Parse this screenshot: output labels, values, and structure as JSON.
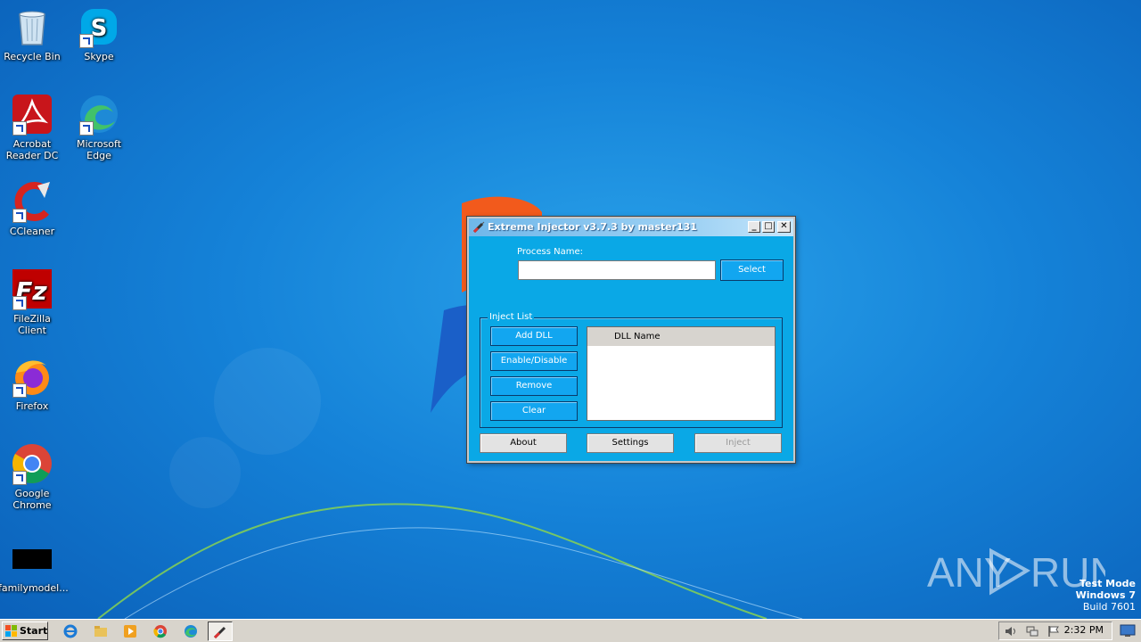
{
  "desktop": {
    "icons": [
      {
        "label": "Recycle Bin"
      },
      {
        "label": "Skype"
      },
      {
        "label": "Acrobat Reader DC"
      },
      {
        "label": "Microsoft Edge"
      },
      {
        "label": "CCleaner"
      },
      {
        "label": "FileZilla Client"
      },
      {
        "label": "Firefox"
      },
      {
        "label": "Google Chrome"
      },
      {
        "label": "familymodel..."
      }
    ]
  },
  "window": {
    "title": "Extreme Injector v3.7.3 by master131",
    "minimize_symbol": "_",
    "maximize_symbol": "□",
    "close_symbol": "✕",
    "process_name_label": "Process Name:",
    "process_name_value": "",
    "select_label": "Select",
    "inject_list_legend": "Inject List",
    "add_dll_label": "Add DLL",
    "enable_disable_label": "Enable/Disable",
    "remove_label": "Remove",
    "clear_label": "Clear",
    "dll_list": {
      "column_header": "DLL Name",
      "rows": []
    },
    "about_label": "About",
    "settings_label": "Settings",
    "inject_label": "Inject",
    "inject_enabled": false
  },
  "taskbar": {
    "start_label": "Start",
    "pinned_apps": [
      "internet-explorer",
      "file-explorer",
      "media-player",
      "chrome",
      "edge",
      "extreme-injector"
    ],
    "clock": "2:32 PM"
  },
  "watermark": {
    "line1": "Test Mode",
    "line2": "Windows 7",
    "line3": "Build 7601",
    "brand": "ANY RUN"
  },
  "colors": {
    "window_bg": "#0aa8e6",
    "button_blue": "#12a6f0",
    "taskbar": "#d8d4cc"
  }
}
